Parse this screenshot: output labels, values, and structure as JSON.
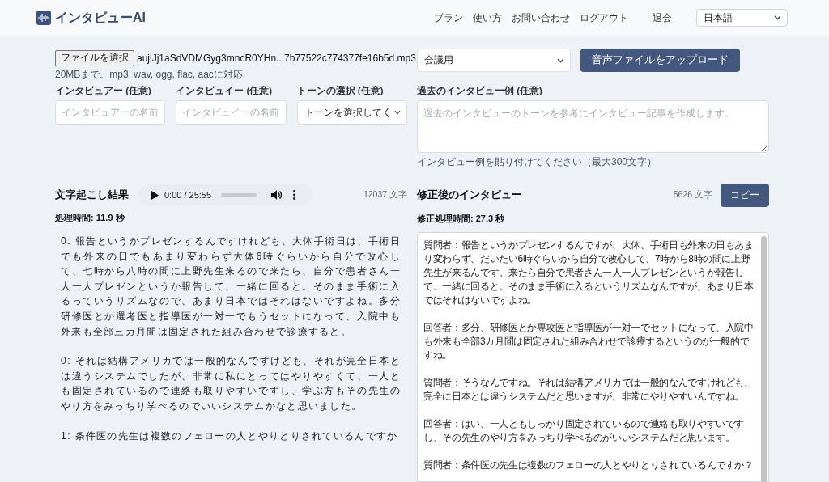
{
  "header": {
    "logo": "インタビューAI",
    "nav": [
      {
        "label": "プラン",
        "kind": "link"
      },
      {
        "label": "使い方",
        "kind": "link"
      },
      {
        "label": "お問い合わせ",
        "kind": "link"
      },
      {
        "label": "ログアウト",
        "kind": "link"
      },
      {
        "label": "退会",
        "kind": "button"
      }
    ],
    "language_select": {
      "value": "日本語"
    }
  },
  "upload": {
    "file_button": "ファイルを選択",
    "file_name": "aujlJj1aSdVDMGyg3mncR0YHn...7b77522c774377fe16b5d.mp3",
    "file_hint": "20MBまで。mp3, wav, ogg, flac, aacに対応",
    "mode_select": {
      "value": "会議用"
    },
    "upload_button": "音声ファイルをアップロード"
  },
  "fields": [
    {
      "kind": "input",
      "label": "インタビュアー (任意)",
      "placeholder": "インタビュアーの名前"
    },
    {
      "kind": "input",
      "label": "インタビュイー (任意)",
      "placeholder": "インタビュイーの名前"
    },
    {
      "kind": "select",
      "label": "トーンの選択 (任意)",
      "value": "トーンを選択してく"
    }
  ],
  "example": {
    "label": "過去のインタビュー例 (任意)",
    "placeholder": "過去のインタビューのトーンを参考にインタビュー記事を作成します。",
    "hint": "インタビュー例を貼り付けてください（最大300文字）"
  },
  "transcript": {
    "title": "文字起こし結果",
    "audio": {
      "time": "0:00 / 25:55"
    },
    "char_count": "12037 文字",
    "processing_time": "処理時間: 11.9 秒",
    "paragraphs": [
      "0: 報告というかプレゼンするんですけれども、大体手術日は、手術日でも外来の日でもあまり変わらず大体6時ぐらいから自分で改心して、七時から八時の間に上野先生来るので来たら、自分で患者さん一人一人プレゼンというか報告して、一緒に回ると。そのまま手術に入るっていうリズムなので、あまり日本ではそれはないですよね。多分研修医とか選考医と指導医が一対一でもうセットになって、入院中も外来も全部三カ月間は固定された組み合わせで診療すると。",
      "0: それは結構アメリカでは一般的なんですけども、それが完全日本とは違うシステムでしたが、非常に私にとってはやりやすくて、一人とも固定されているので連絡も取りやすいですし、学ぶ方もその先生のやり方をみっちり学べるのでいいシステムかなと思いました。",
      "1: 条件医の先生は複数のフェローの人とやりとりされているんですか"
    ]
  },
  "revised": {
    "title": "修正後のインタビュー",
    "char_count": "5626 文字",
    "copy_button": "コピー",
    "processing_time": "修正処理時間: 27.3 秒",
    "paragraphs": [
      "質問者：報告というかプレゼンするんですが、大体、手術日も外来の日もあまり変わらず、だいたい6時ぐらいから自分で改心して、7時から8時の間に上野先生が来るんです。来たら自分で患者さん一人一人プレゼンというか報告して、一緒に回ると。そのまま手術に入るというリズムなんですが、あまり日本ではそれはないですよね。",
      "回答者：多分、研修医とか専攻医と指導医が一対一でセットになって、入院中も外来も全部3カ月間は固定された組み合わせで診療するというのが一般的ですね。",
      "質問者：そうなんですね。それは結構アメリカでは一般的なんですけれども、完全に日本とは違うシステムだと思いますが、非常にやりやすいんですね。",
      "回答者：はい、一人ともしっかり固定されているので連絡も取りやすいですし、その先生のやり方をみっちり学べるのがいいシステムだと思います。",
      "質問者：条件医の先生は複数のフェローの人とやりとりされているんですか？"
    ]
  }
}
